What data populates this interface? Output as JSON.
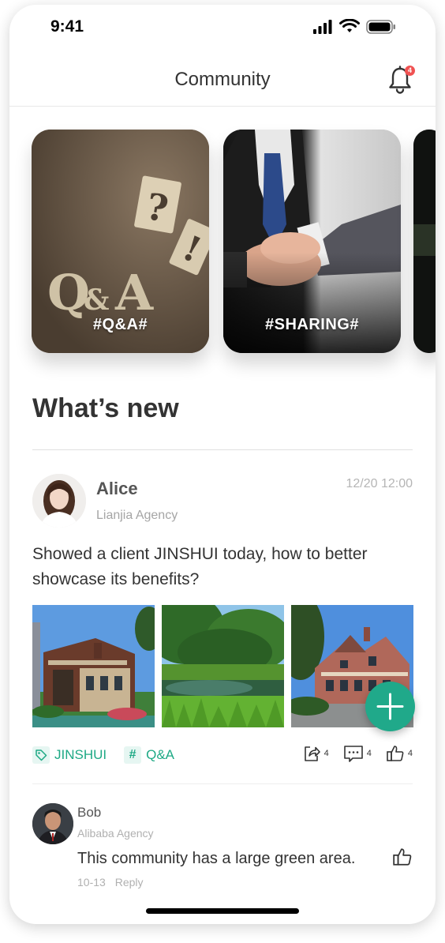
{
  "status_bar": {
    "time": "9:41"
  },
  "header": {
    "title": "Community",
    "notification_count": "4"
  },
  "topics": [
    {
      "label": "#Q&A#"
    },
    {
      "label": "#SHARING#"
    }
  ],
  "section": {
    "title": "What’s new"
  },
  "post": {
    "author": "Alice",
    "agency": "Lianjia Agency",
    "time": "12/20 12:00",
    "text": "Showed a client JINSHUI today, how to better showcase its benefits?",
    "tags": [
      {
        "label": "JINSHUI",
        "icon": "tag-icon"
      },
      {
        "label": "Q&A",
        "icon": "hashtag-icon"
      }
    ],
    "shares": "4",
    "comments": "4",
    "likes": "4"
  },
  "comment": {
    "author": "Bob",
    "agency": "Alibaba Agency",
    "text": "This community has a large green area.",
    "date": "10-13",
    "reply_label": "Reply"
  },
  "colors": {
    "accent": "#1ea985",
    "badge": "#f05252"
  }
}
